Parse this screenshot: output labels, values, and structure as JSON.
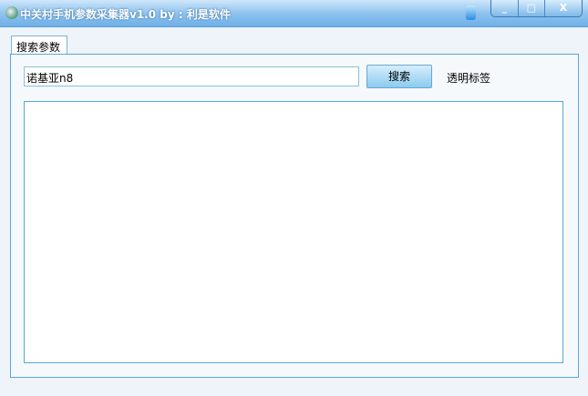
{
  "window": {
    "title": "中关村手机参数采集器v1.0  by : 利是软件",
    "controls": {
      "minimize": "_",
      "maximize": "□",
      "close": "X"
    }
  },
  "tabs": [
    {
      "label": "搜索参数"
    }
  ],
  "search": {
    "value": "诺基亚n8",
    "button_label": "搜索"
  },
  "transparent_label": "透明标签",
  "output": {
    "value": ""
  }
}
